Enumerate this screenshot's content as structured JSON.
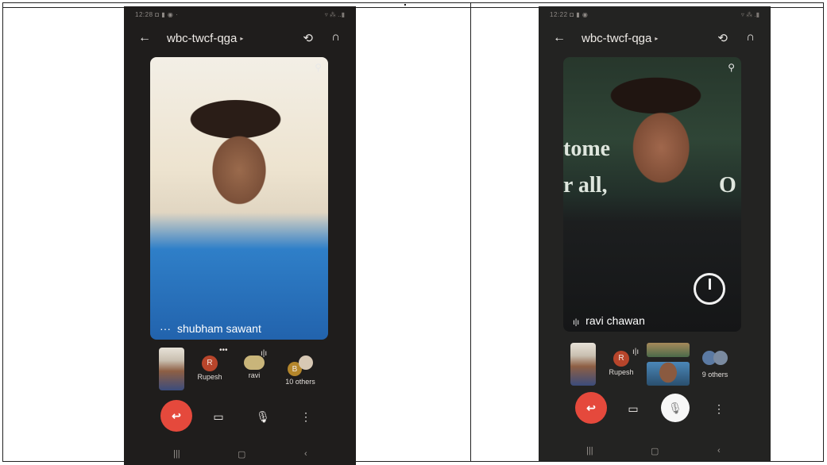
{
  "panels": [
    {
      "status_time": "12:28 ◘ ▮ ◉ ·",
      "status_right": "▿ ⁂ ..▮",
      "meeting_title": "wbc-twcf-qga",
      "caret": "▸",
      "speaker_name": "shubham sawant",
      "speaker_prefix": "···",
      "participants": [
        {
          "initial": "R",
          "label": "Rupesh"
        },
        {
          "initial": "",
          "label": "ravi"
        },
        {
          "initial": "B",
          "label": "10 others"
        }
      ]
    },
    {
      "status_time": "12:22 ◘ ▮ ◉",
      "status_right": "▿ ⁂ .▮",
      "meeting_title": "wbc-twcf-qga",
      "caret": "▸",
      "speaker_name": "ravi chawan",
      "speaker_prefix": "ı|ı",
      "bg_text_1": "tome",
      "bg_text_2": "r all, ",
      "bg_text_3": "O",
      "participants": [
        {
          "initial": "R",
          "label": "Rupesh"
        },
        {
          "initial": "",
          "label": "9 others"
        }
      ]
    }
  ],
  "icons": {
    "back": "←",
    "switch_camera": "⟲",
    "audio": "∩",
    "pin": "⚲",
    "end_call": "↩",
    "camera": "▭",
    "mic": "🎙",
    "mic_off": "🎙",
    "more": "⋮",
    "nav_recent": "|||",
    "nav_home": "▢",
    "nav_back": "‹"
  },
  "colors": {
    "end_call": "#e5493c",
    "phone_bg": "#1f1d1c"
  }
}
